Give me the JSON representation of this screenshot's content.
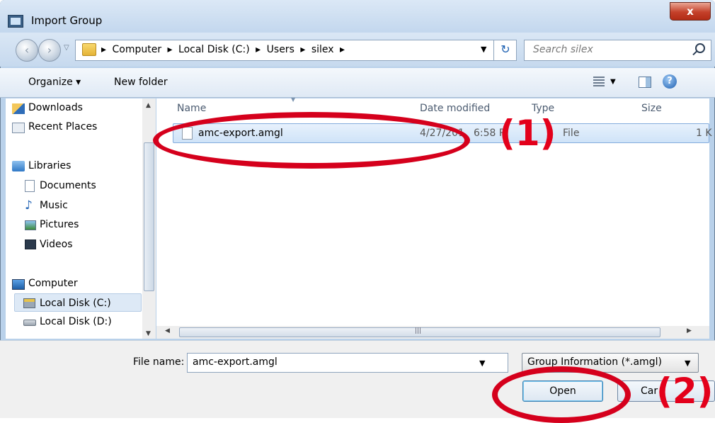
{
  "window": {
    "title": "Import Group",
    "close_glyph": "x"
  },
  "address": {
    "crumbs": [
      "▸",
      "Computer",
      "▸",
      "Local Disk (C:)",
      "▸",
      "Users",
      "▸",
      "silex",
      "▸"
    ],
    "search_placeholder": "Search silex"
  },
  "toolbar": {
    "organize": "Organize ▾",
    "new_folder": "New folder"
  },
  "nav": {
    "items": [
      "Downloads",
      "Recent Places",
      "Libraries",
      "Documents",
      "Music",
      "Pictures",
      "Videos",
      "Computer",
      "Local Disk (C:)",
      "Local Disk (D:)"
    ],
    "selected": "Local Disk (C:)"
  },
  "columns": {
    "name": "Name",
    "date": "Date modified",
    "type": "Type",
    "size": "Size"
  },
  "file": {
    "name": "amc-export.amgl",
    "date": "4/27/201",
    "date2": "6:58 P",
    "type": "File",
    "size": "1 K"
  },
  "bottom": {
    "filename_label": "File name:",
    "filename_value": "amc-export.amgl",
    "filetype_value": "Group Information (*.amgl)",
    "open": "Open",
    "cancel": "Car"
  },
  "annotations": {
    "one": "(1)",
    "two": "(2)"
  },
  "colors": {
    "accent": "#d5001c",
    "selection": "#cfe3f8",
    "chrome": "#c6d9ee"
  }
}
